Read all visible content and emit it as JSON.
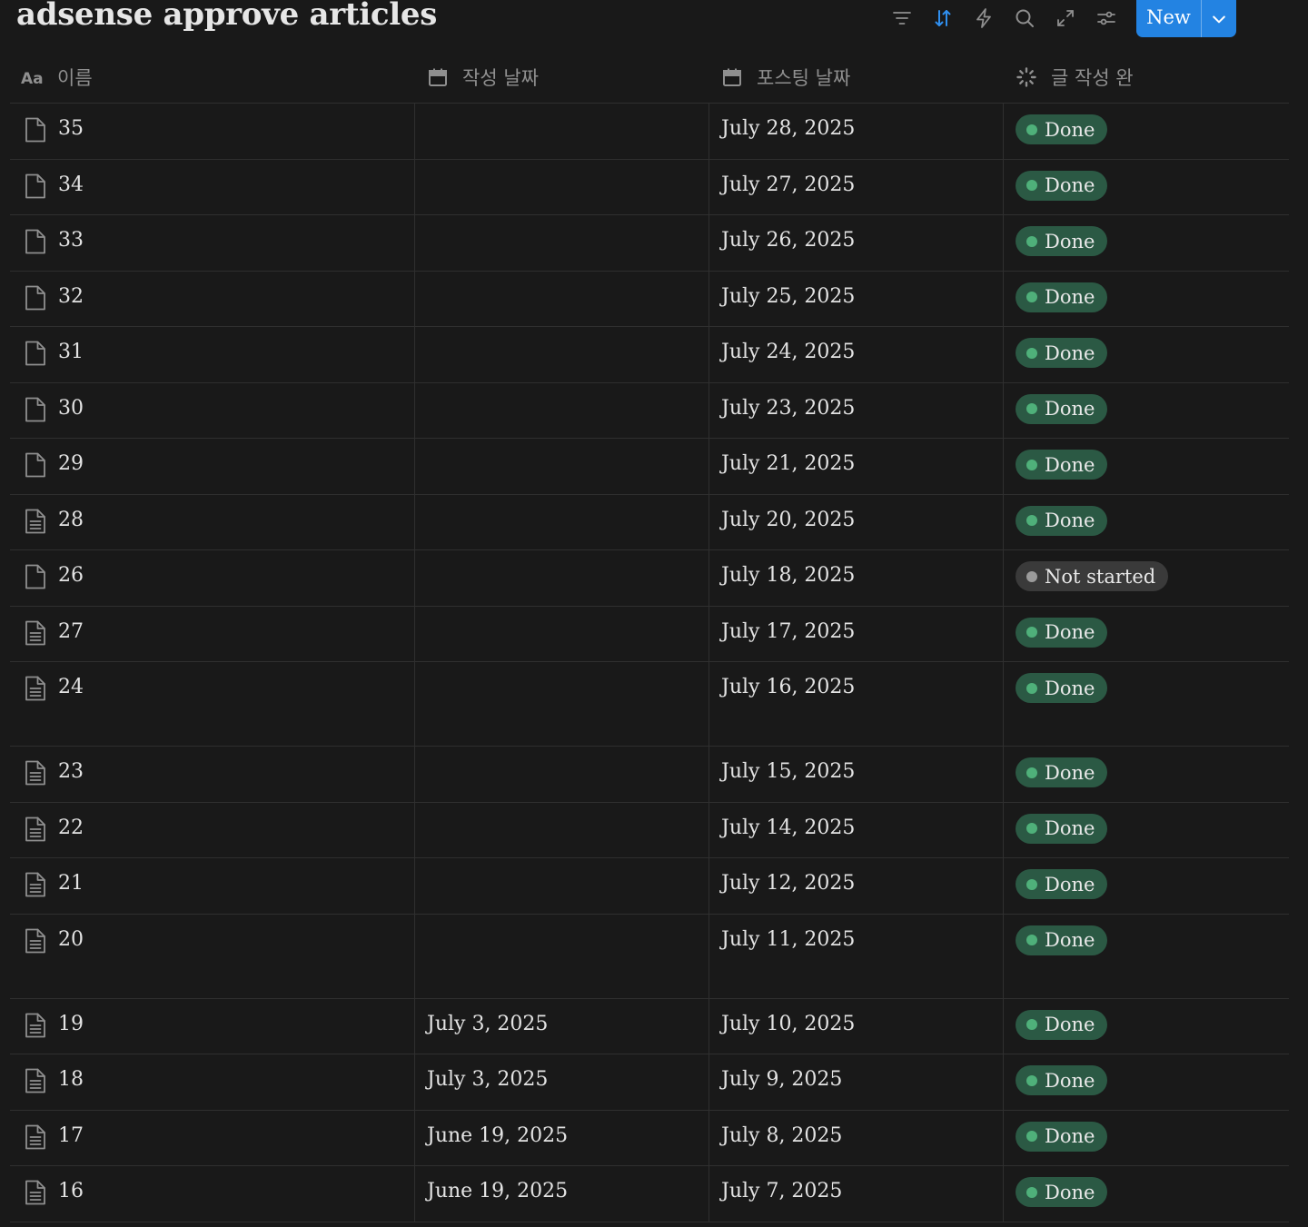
{
  "title": "adsense approve articles",
  "toolbar": {
    "new_label": "New",
    "icons": [
      "filter-icon",
      "sort-icon",
      "automation-icon",
      "search-icon",
      "expand-icon",
      "settings-icon"
    ],
    "accent": "#2383e2"
  },
  "columns": {
    "name": "이름",
    "written_date": "작성 날짜",
    "posting_date": "포스팅 날짜",
    "status": "글 작성 완"
  },
  "status_colors": {
    "done_bg": "#2b5944",
    "done_dot": "#4fb07a",
    "not_started_bg": "#3a3a3a",
    "not_started_dot": "#9b9b9b"
  },
  "rows": [
    {
      "name": "35",
      "written": "",
      "posted": "July 28, 2025",
      "status": "Done",
      "icon": "blank"
    },
    {
      "name": "34",
      "written": "",
      "posted": "July 27, 2025",
      "status": "Done",
      "icon": "blank"
    },
    {
      "name": "33",
      "written": "",
      "posted": "July 26, 2025",
      "status": "Done",
      "icon": "blank"
    },
    {
      "name": "32",
      "written": "",
      "posted": "July 25, 2025",
      "status": "Done",
      "icon": "blank"
    },
    {
      "name": "31",
      "written": "",
      "posted": "July 24, 2025",
      "status": "Done",
      "icon": "blank"
    },
    {
      "name": "30",
      "written": "",
      "posted": "July 23, 2025",
      "status": "Done",
      "icon": "blank"
    },
    {
      "name": "29",
      "written": "",
      "posted": "July 21, 2025",
      "status": "Done",
      "icon": "blank"
    },
    {
      "name": "28",
      "written": "",
      "posted": "July 20, 2025",
      "status": "Done",
      "icon": "lined"
    },
    {
      "name": "26",
      "written": "",
      "posted": "July 18, 2025",
      "status": "Not started",
      "icon": "blank"
    },
    {
      "name": "27",
      "written": "",
      "posted": "July 17, 2025",
      "status": "Done",
      "icon": "lined"
    },
    {
      "name": "24",
      "written": "",
      "posted": "July 16, 2025",
      "status": "Done",
      "icon": "lined",
      "tall": true
    },
    {
      "name": "23",
      "written": "",
      "posted": "July 15, 2025",
      "status": "Done",
      "icon": "lined"
    },
    {
      "name": "22",
      "written": "",
      "posted": "July 14, 2025",
      "status": "Done",
      "icon": "lined"
    },
    {
      "name": "21",
      "written": "",
      "posted": "July 12, 2025",
      "status": "Done",
      "icon": "lined"
    },
    {
      "name": "20",
      "written": "",
      "posted": "July 11, 2025",
      "status": "Done",
      "icon": "lined",
      "tall": true
    },
    {
      "name": "19",
      "written": "July 3, 2025",
      "posted": "July 10, 2025",
      "status": "Done",
      "icon": "lined"
    },
    {
      "name": "18",
      "written": "July 3, 2025",
      "posted": "July 9, 2025",
      "status": "Done",
      "icon": "lined"
    },
    {
      "name": "17",
      "written": "June 19, 2025",
      "posted": "July 8, 2025",
      "status": "Done",
      "icon": "lined"
    },
    {
      "name": "16",
      "written": "June 19, 2025",
      "posted": "July 7, 2025",
      "status": "Done",
      "icon": "lined"
    }
  ]
}
